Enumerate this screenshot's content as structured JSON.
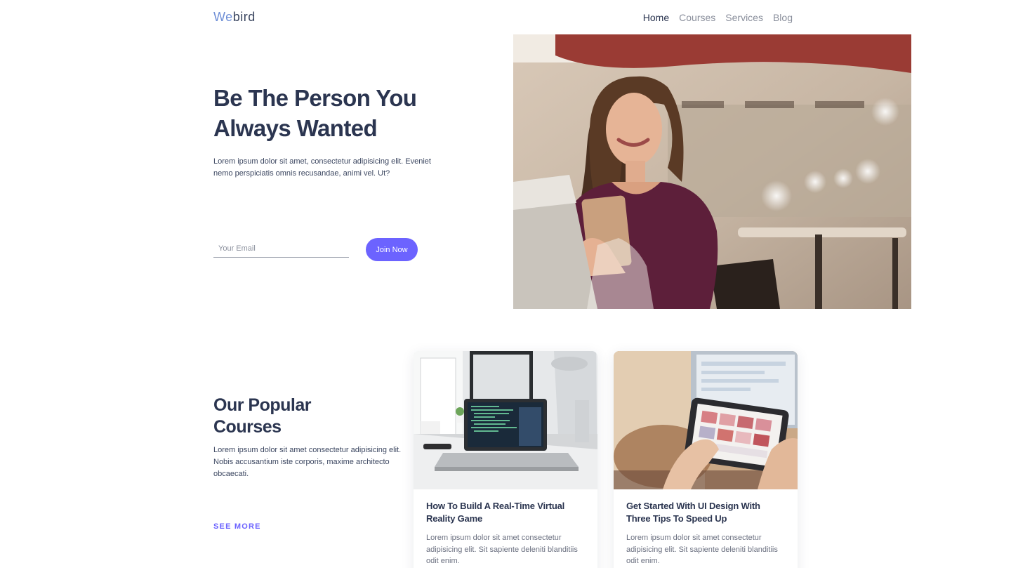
{
  "brand": {
    "prefix": "We",
    "suffix": "bird"
  },
  "nav": {
    "items": [
      {
        "label": "Home",
        "active": true
      },
      {
        "label": "Courses",
        "active": false
      },
      {
        "label": "Services",
        "active": false
      },
      {
        "label": "Blog",
        "active": false
      }
    ]
  },
  "hero": {
    "title_line1": "Be The Person You",
    "title_line2": "Always Wanted",
    "text": "Lorem ipsum dolor sit amet, consectetur adipisicing elit. Eveniet nemo perspiciatis omnis recusandae, animi vel. Ut?",
    "email_placeholder": "Your Email",
    "email_value": "",
    "join_label": "Join Now",
    "image_icon": "woman-with-phone-photo"
  },
  "courses": {
    "title_line1": "Our Popular",
    "title_line2": "Courses",
    "text": "Lorem ipsum dolor sit amet consectetur adipisicing elit. Nobis accusantium iste corporis, maxime architecto obcaecati.",
    "see_more_label": "SEE MORE",
    "cards": [
      {
        "title": "How To Build A Real-Time Virtual Reality Game",
        "text": "Lorem ipsum dolor sit amet consectetur adipisicing elit. Sit sapiente deleniti blanditiis odit enim.",
        "image_icon": "laptop-desk-photo"
      },
      {
        "title": "Get Started With UI Design With Three Tips To Speed Up",
        "text": "Lorem ipsum dolor sit amet consectetur adipisicing elit. Sit sapiente deleniti blanditiis odit enim.",
        "image_icon": "tablet-hands-photo"
      }
    ]
  },
  "colors": {
    "accent": "#6c63ff",
    "heading": "#2b3550",
    "brand_prefix": "#6f8fd6"
  }
}
